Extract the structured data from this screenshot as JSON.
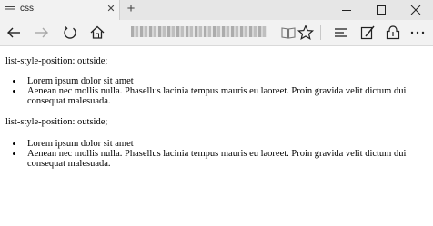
{
  "browser": {
    "tab_title": "css",
    "new_tab": "+",
    "tab_close": "✕",
    "icons": [
      "tab-page-icon",
      "back-arrow-icon",
      "forward-arrow-icon",
      "refresh-icon",
      "home-icon",
      "reading-view-icon",
      "favorites-star-icon",
      "hub-icon",
      "web-note-icon",
      "share-icon",
      "more-icon",
      "minimize-icon",
      "maximize-icon",
      "close-icon"
    ]
  },
  "content": {
    "sections": [
      {
        "label": "list-style-position: outside;",
        "items": [
          "Lorem ipsum dolor sit amet",
          "Aenean nec mollis nulla. Phasellus lacinia tempus mauris eu laoreet. Proin gravida velit dictum dui consequat malesuada."
        ]
      },
      {
        "label": "list-style-position: outside;",
        "items": [
          "Lorem ipsum dolor sit amet",
          "Aenean nec mollis nulla. Phasellus lacinia tempus mauris eu laoreet. Proin gravida velit dictum dui consequat malesuada."
        ]
      }
    ]
  }
}
